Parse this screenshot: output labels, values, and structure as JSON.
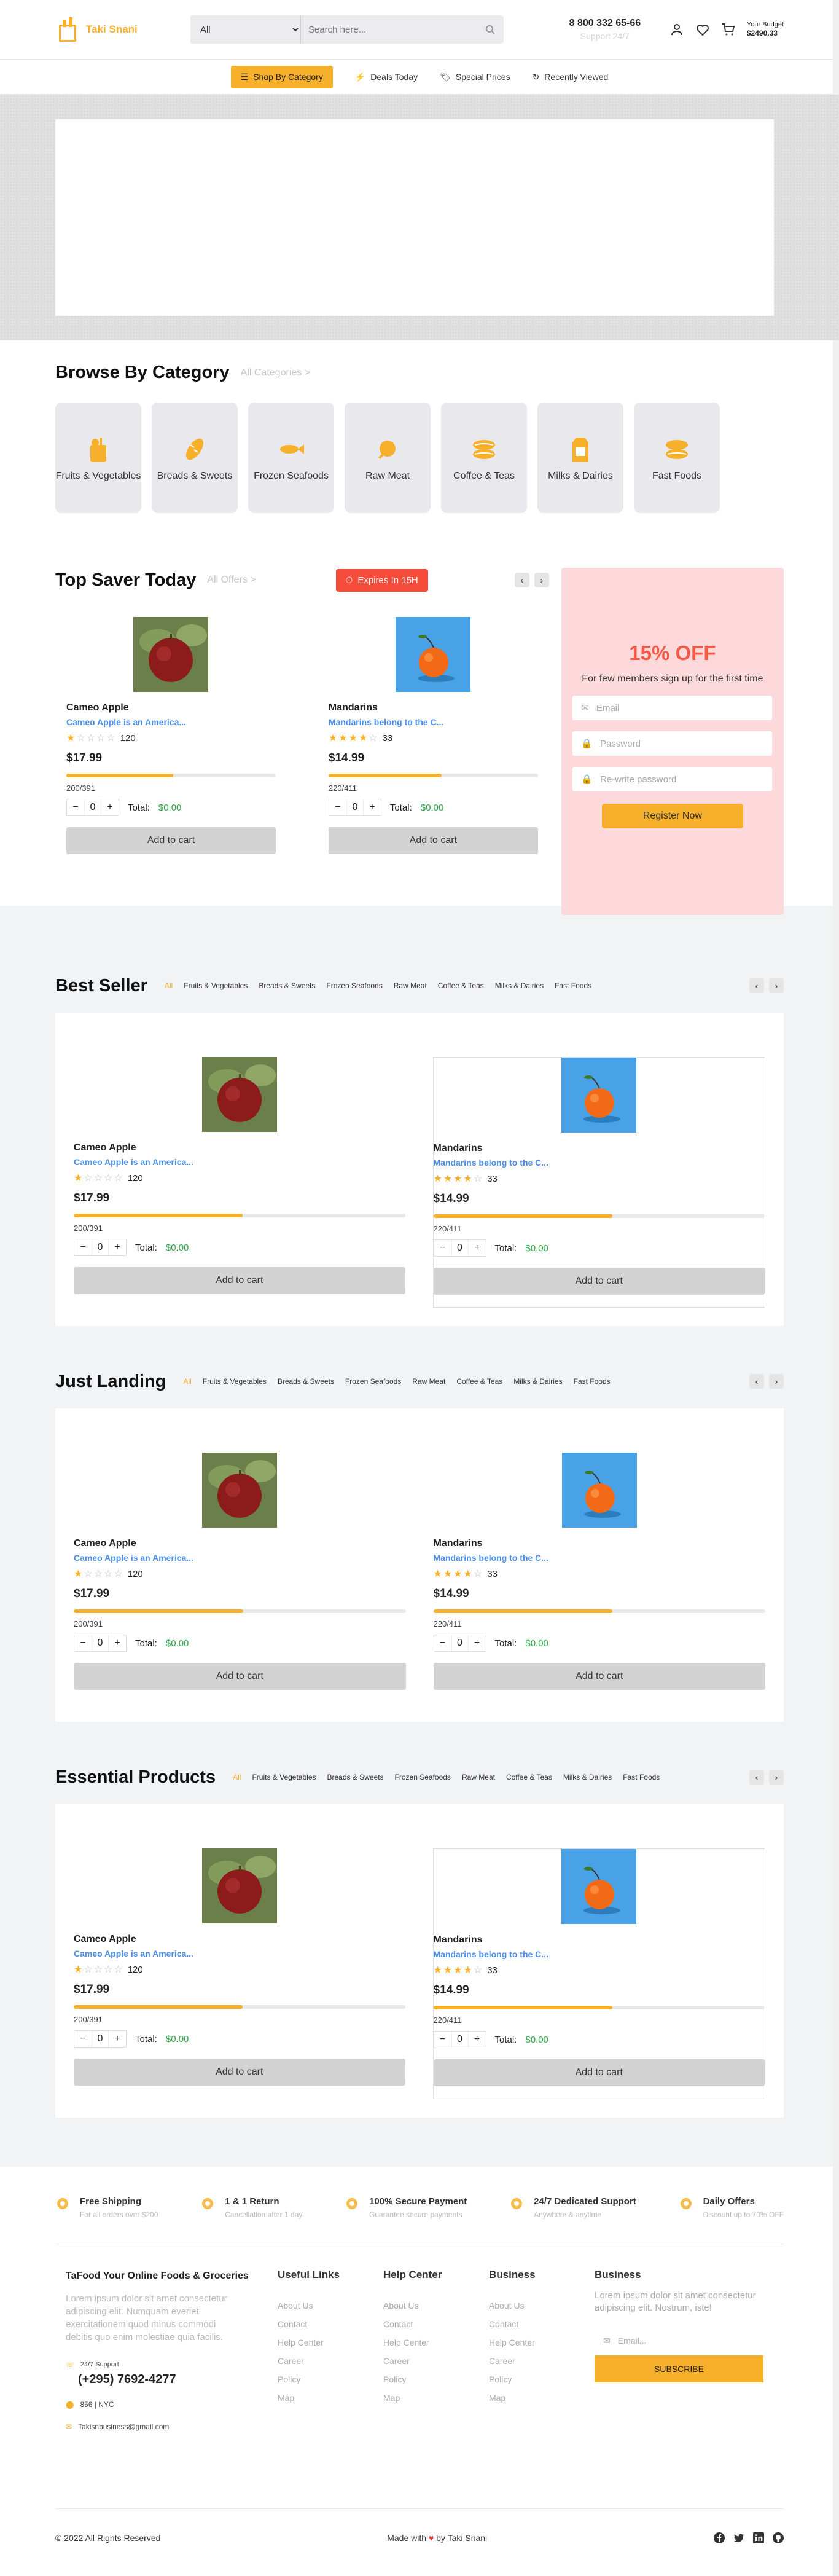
{
  "header": {
    "brand": "Taki Snani",
    "search_category": "All",
    "search_placeholder": "Search here...",
    "phone": "8 800 332 65-66",
    "support": "Support 24/7",
    "budget_label": "Your Budget",
    "budget_value": "$2490.33"
  },
  "nav": {
    "category_button": "Shop By Category",
    "items": [
      "Deals Today",
      "Special Prices",
      "Recently Viewed"
    ]
  },
  "browse": {
    "title": "Browse By Category",
    "link": "All Categories >",
    "categories": [
      "Fruits & Vegetables",
      "Breads & Sweets",
      "Frozen Seafoods",
      "Raw Meat",
      "Coffee & Teas",
      "Milks & Dairies",
      "Fast Foods"
    ]
  },
  "saver": {
    "title": "Top Saver Today",
    "link": "All Offers >",
    "expires": "Expires In 15H"
  },
  "products": [
    {
      "name": "Cameo Apple",
      "desc": "Cameo Apple is an America...",
      "stars": 1,
      "reviews": "120",
      "price": "$17.99",
      "sold_fraction": 0.51,
      "sold": "200/391",
      "qty": "0",
      "total_label": "Total:",
      "total": "$0.00",
      "cart": "Add to cart"
    },
    {
      "name": "Mandarins",
      "desc": "Mandarins belong to the C...",
      "stars": 4,
      "reviews": "33",
      "price": "$14.99",
      "sold_fraction": 0.54,
      "sold": "220/411",
      "qty": "0",
      "total_label": "Total:",
      "total": "$0.00",
      "cart": "Add to cart"
    }
  ],
  "promo": {
    "headline": "15% OFF",
    "sub": "For few members sign up for the first time",
    "email": "Email",
    "password": "Password",
    "rewrite": "Re-write password",
    "register": "Register Now"
  },
  "shelves": [
    {
      "title": "Best Seller"
    },
    {
      "title": "Just Landing"
    },
    {
      "title": "Essential Products"
    }
  ],
  "tabs": [
    "All",
    "Fruits & Vegetables",
    "Breads & Sweets",
    "Frozen Seafoods",
    "Raw Meat",
    "Coffee & Teas",
    "Milks & Dairies",
    "Fast Foods"
  ],
  "features": [
    {
      "title": "Free Shipping",
      "sub": "For all orders over $200"
    },
    {
      "title": "1 & 1 Return",
      "sub": "Cancellation after 1 day"
    },
    {
      "title": "100% Secure Payment",
      "sub": "Guarantee secure payments"
    },
    {
      "title": "24/7 Dedicated Support",
      "sub": "Anywhere & anytime"
    },
    {
      "title": "Daily Offers",
      "sub": "Discount up to 70% OFF"
    }
  ],
  "footer": {
    "brand_title": "TaFood Your Online Foods & Groceries",
    "brand_desc": "Lorem ipsum dolor sit amet consectetur adipiscing elit. Numquam everiet exercitationem quod minus commodi debitis quo enim molestiae quia facilis.",
    "support_label": "24/7 Support",
    "support_phone": "(+295) 7692-4277",
    "address": "856 | NYC",
    "email": "Takisnbusiness@gmail.com",
    "columns": [
      {
        "title": "Useful Links",
        "links": [
          "About Us",
          "Contact",
          "Help Center",
          "Career",
          "Policy",
          "Map"
        ]
      },
      {
        "title": "Help Center",
        "links": [
          "About Us",
          "Contact",
          "Help Center",
          "Career",
          "Policy",
          "Map"
        ]
      },
      {
        "title": "Business",
        "links": [
          "About Us",
          "Contact",
          "Help Center",
          "Career",
          "Policy",
          "Map"
        ]
      }
    ],
    "newsletter_title": "Business",
    "newsletter_desc": "Lorem ipsum dolor sit amet consectetur adipiscing elit. Nostrum, iste!",
    "newsletter_placeholder": "Email...",
    "subscribe": "SUBSCRIBE",
    "copyright": "© 2022 All Rights Reserved",
    "made_with": "Made with",
    "made_by": "by Taki Snani"
  }
}
